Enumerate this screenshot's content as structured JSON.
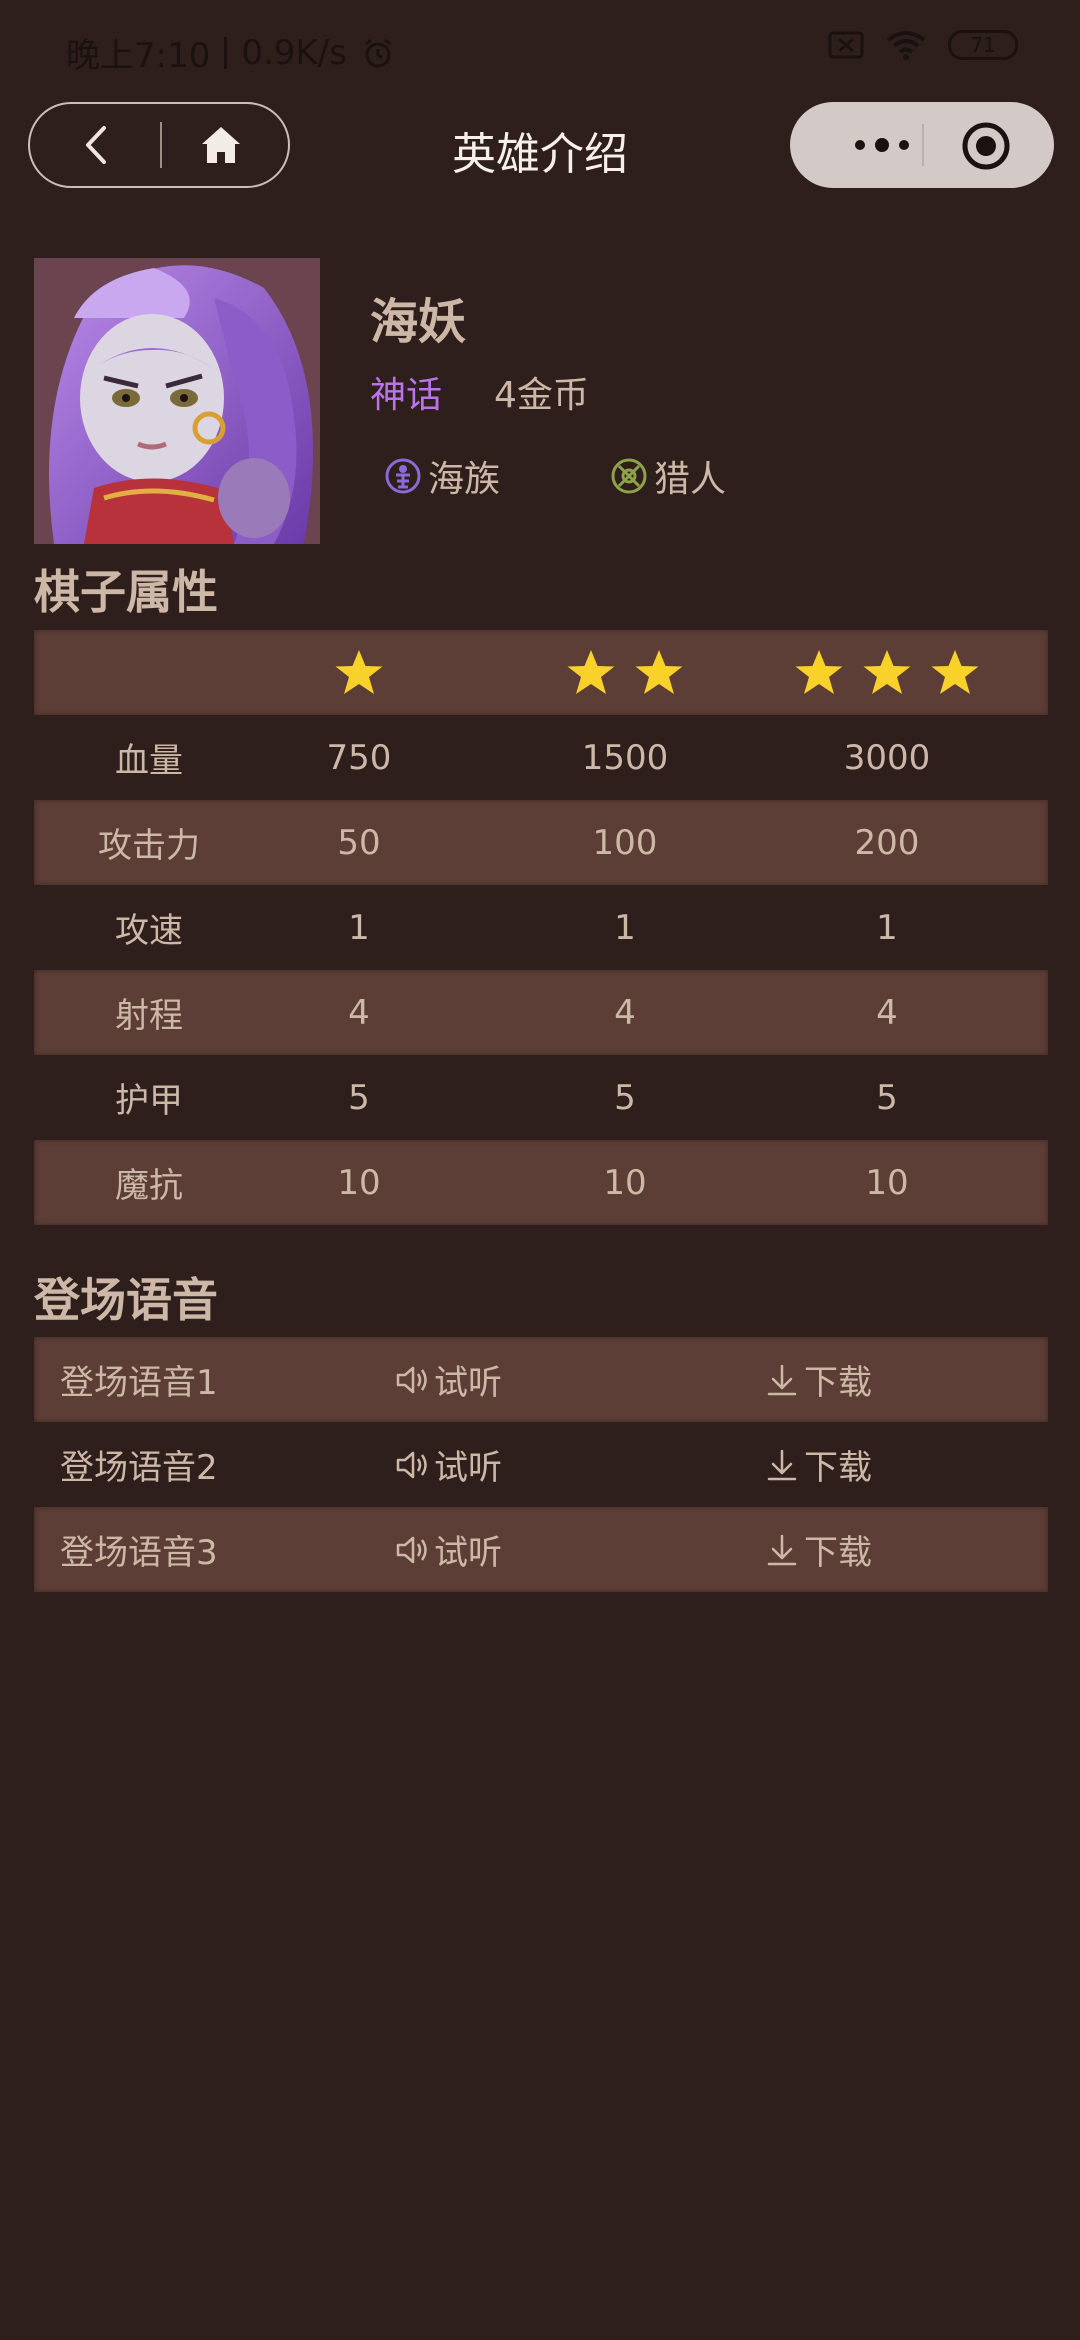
{
  "status_bar": {
    "time": "晚上7:10",
    "speed": "0.9K/s",
    "battery": "71",
    "icons": [
      "alarm-icon",
      "sim-off-icon",
      "wifi-icon",
      "battery-icon"
    ]
  },
  "nav": {
    "title": "英雄介绍",
    "back_icon": "chevron-left-icon",
    "home_icon": "home-icon",
    "menu_icon": "more-dots-icon",
    "close_icon": "target-circle-icon"
  },
  "hero": {
    "name": "海妖",
    "rarity": "神话",
    "cost": "4金币",
    "traits": [
      {
        "label": "海族",
        "icon": "sea-race-icon",
        "color": "#8a6ad6"
      },
      {
        "label": "猎人",
        "icon": "hunter-icon",
        "color": "#8ea24a"
      }
    ]
  },
  "attributes": {
    "section_title": "棋子属性",
    "star_levels": [
      1,
      2,
      3
    ],
    "rows": [
      {
        "label": "血量",
        "values": [
          "750",
          "1500",
          "3000"
        ]
      },
      {
        "label": "攻击力",
        "values": [
          "50",
          "100",
          "200"
        ]
      },
      {
        "label": "攻速",
        "values": [
          "1",
          "1",
          "1"
        ]
      },
      {
        "label": "射程",
        "values": [
          "4",
          "4",
          "4"
        ]
      },
      {
        "label": "护甲",
        "values": [
          "5",
          "5",
          "5"
        ]
      },
      {
        "label": "魔抗",
        "values": [
          "10",
          "10",
          "10"
        ]
      }
    ]
  },
  "voices": {
    "section_title": "登场语音",
    "listen_label": "试听",
    "download_label": "下载",
    "items": [
      {
        "name": "登场语音1"
      },
      {
        "name": "登场语音2"
      },
      {
        "name": "登场语音3"
      }
    ]
  },
  "colors": {
    "background": "#2e1f1d",
    "row_shade": "#5d3e36",
    "text": "#cdb8a8",
    "rarity": "#b974e8",
    "star": "#f8d12a"
  }
}
